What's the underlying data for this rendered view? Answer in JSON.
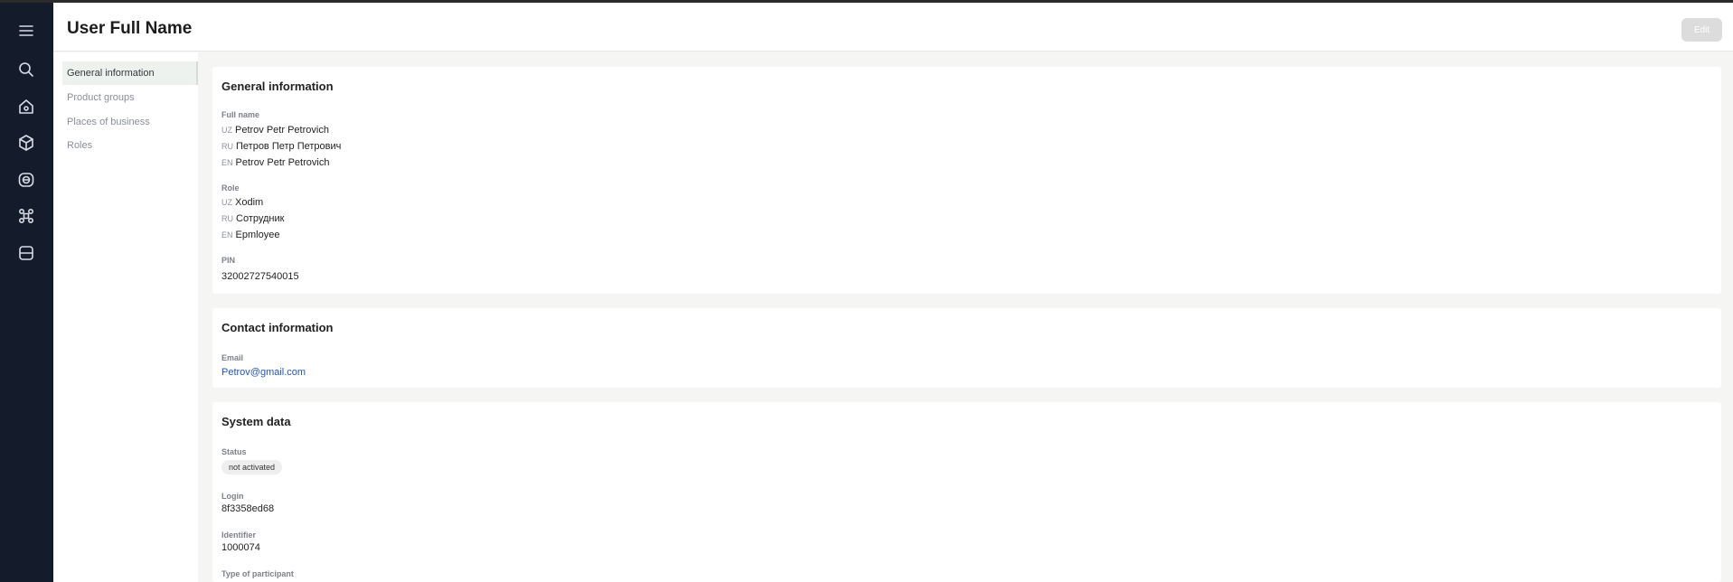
{
  "header": {
    "title": "User Full Name",
    "edit_label": "Edit"
  },
  "rail": {
    "icons": [
      "menu-icon",
      "search-icon",
      "home-icon",
      "box-icon",
      "scan-icon",
      "nodes-icon",
      "storage-icon"
    ]
  },
  "subnav": {
    "items": [
      {
        "label": "General information",
        "active": true
      },
      {
        "label": "Product groups"
      },
      {
        "label": "Places of business"
      },
      {
        "label": "Roles"
      }
    ]
  },
  "general": {
    "title": "General information",
    "full_name": {
      "label": "Full name",
      "values": [
        {
          "lang": "UZ",
          "text": "Petrov Petr Petrovich"
        },
        {
          "lang": "RU",
          "text": "Петров Петр Петрович"
        },
        {
          "lang": "EN",
          "text": "Petrov Petr Petrovich"
        }
      ]
    },
    "role": {
      "label": "Role",
      "values": [
        {
          "lang": "UZ",
          "text": "Xodim"
        },
        {
          "lang": "RU",
          "text": "Сотрудник"
        },
        {
          "lang": "EN",
          "text": "Epmloyee"
        }
      ]
    },
    "pin": {
      "label": "PIN",
      "value": "32002727540015"
    }
  },
  "contact": {
    "title": "Contact information",
    "email": {
      "label": "Email",
      "value": "Petrov@gmail.com"
    }
  },
  "system": {
    "title": "System data",
    "status": {
      "label": "Status",
      "value": "not activated"
    },
    "login": {
      "label": "Login",
      "value": "8f3358ed68"
    },
    "identifier": {
      "label": "Identifier",
      "value": "1000074"
    },
    "participant": {
      "label": "Type of participant"
    }
  },
  "colors": {
    "rail": "#141b2b",
    "link": "#2452c9",
    "active_nav": "#eef2ee"
  }
}
